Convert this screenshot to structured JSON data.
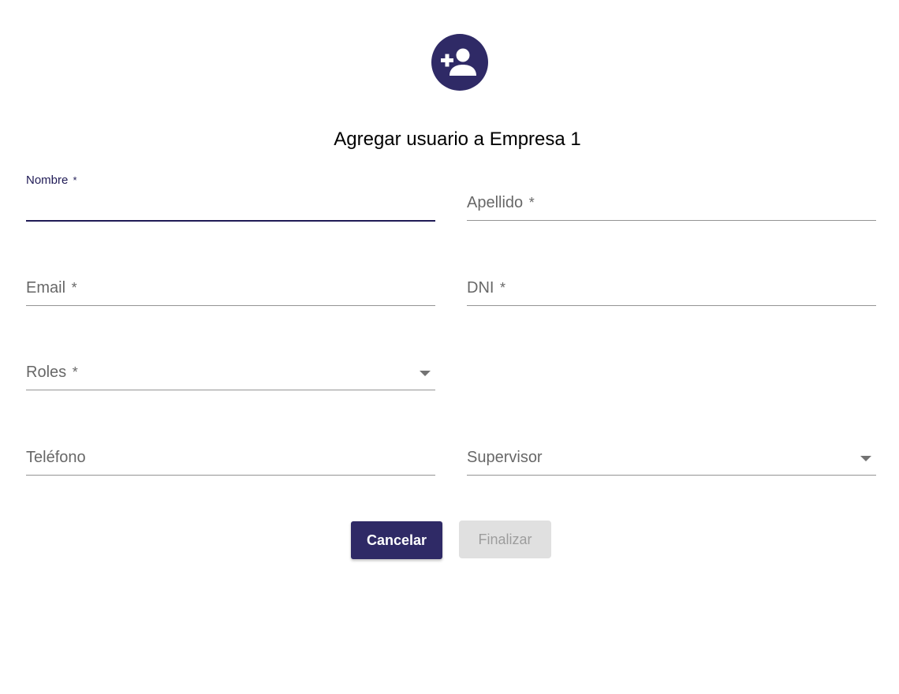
{
  "header": {
    "icon": "add-user-icon",
    "accent_color": "#2f2a66",
    "title": "Agregar usuario a Empresa 1"
  },
  "form": {
    "nombre": {
      "label": "Nombre",
      "required_mark": "*",
      "value": "",
      "state": "focused"
    },
    "apellido": {
      "label": "Apellido",
      "required_mark": "*",
      "value": ""
    },
    "email": {
      "label": "Email",
      "required_mark": "*",
      "value": ""
    },
    "dni": {
      "label": "DNI",
      "required_mark": "*",
      "value": ""
    },
    "roles": {
      "label": "Roles",
      "required_mark": "*",
      "value": "",
      "type": "select"
    },
    "telefono": {
      "label": "Teléfono",
      "value": ""
    },
    "supervisor": {
      "label": "Supervisor",
      "value": "",
      "type": "select"
    }
  },
  "actions": {
    "cancel_label": "Cancelar",
    "finish_label": "Finalizar",
    "finish_disabled": true
  }
}
